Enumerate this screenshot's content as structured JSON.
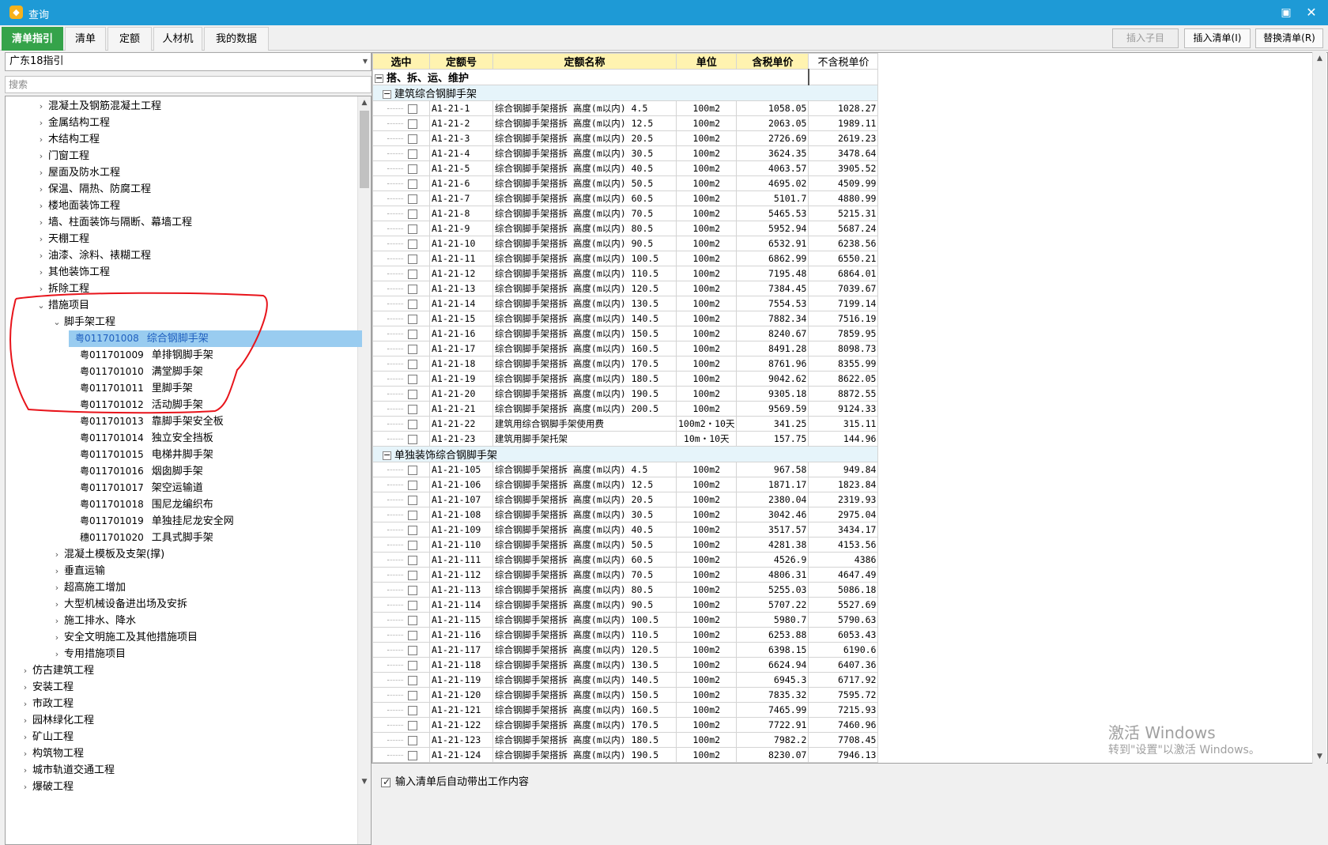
{
  "window": {
    "title": "查询",
    "icon": "app-icon"
  },
  "tabs": [
    {
      "label": "清单指引",
      "active": true
    },
    {
      "label": "清单"
    },
    {
      "label": "定额"
    },
    {
      "label": "人材机"
    },
    {
      "label": "我的数据"
    }
  ],
  "actions": {
    "insert_child": "插入子目",
    "insert_list": "插入清单(I)",
    "replace_list": "替换清单(R)"
  },
  "left": {
    "combo_value": "广东18指引",
    "search_placeholder": "搜索",
    "tree": [
      {
        "level": 1,
        "label": "混凝土及钢筋混凝土工程",
        "exp": "c"
      },
      {
        "level": 1,
        "label": "金属结构工程",
        "exp": "c"
      },
      {
        "level": 1,
        "label": "木结构工程",
        "exp": "c"
      },
      {
        "level": 1,
        "label": "门窗工程",
        "exp": "c"
      },
      {
        "level": 1,
        "label": "屋面及防水工程",
        "exp": "c"
      },
      {
        "level": 1,
        "label": "保温、隔热、防腐工程",
        "exp": "c"
      },
      {
        "level": 1,
        "label": "楼地面装饰工程",
        "exp": "c"
      },
      {
        "level": 1,
        "label": "墙、柱面装饰与隔断、幕墙工程",
        "exp": "c"
      },
      {
        "level": 1,
        "label": "天棚工程",
        "exp": "c"
      },
      {
        "level": 1,
        "label": "油漆、涂料、裱糊工程",
        "exp": "c"
      },
      {
        "level": 1,
        "label": "其他装饰工程",
        "exp": "c"
      },
      {
        "level": 1,
        "label": "拆除工程",
        "exp": "c"
      },
      {
        "level": 1,
        "label": "措施项目",
        "exp": "o"
      },
      {
        "level": 2,
        "label": "脚手架工程",
        "exp": "o"
      },
      {
        "level": 3,
        "code": "粤011701008",
        "label": "综合钢脚手架",
        "selected": true
      },
      {
        "level": 3,
        "code": "粤011701009",
        "label": "单排钢脚手架"
      },
      {
        "level": 3,
        "code": "粤011701010",
        "label": "满堂脚手架"
      },
      {
        "level": 3,
        "code": "粤011701011",
        "label": "里脚手架"
      },
      {
        "level": 3,
        "code": "粤011701012",
        "label": "活动脚手架"
      },
      {
        "level": 3,
        "code": "粤011701013",
        "label": "靠脚手架安全板"
      },
      {
        "level": 3,
        "code": "粤011701014",
        "label": "独立安全挡板"
      },
      {
        "level": 3,
        "code": "粤011701015",
        "label": "电梯井脚手架"
      },
      {
        "level": 3,
        "code": "粤011701016",
        "label": "烟囱脚手架"
      },
      {
        "level": 3,
        "code": "粤011701017",
        "label": "架空运输道"
      },
      {
        "level": 3,
        "code": "粤011701018",
        "label": "围尼龙编织布"
      },
      {
        "level": 3,
        "code": "粤011701019",
        "label": "单独挂尼龙安全网"
      },
      {
        "level": 3,
        "code": "穗011701020",
        "label": "工具式脚手架"
      },
      {
        "level": 2,
        "label": "混凝土模板及支架(撑)",
        "exp": "c"
      },
      {
        "level": 2,
        "label": "垂直运输",
        "exp": "c"
      },
      {
        "level": 2,
        "label": "超高施工增加",
        "exp": "c"
      },
      {
        "level": 2,
        "label": "大型机械设备进出场及安拆",
        "exp": "c"
      },
      {
        "level": 2,
        "label": "施工排水、降水",
        "exp": "c"
      },
      {
        "level": 2,
        "label": "安全文明施工及其他措施项目",
        "exp": "c"
      },
      {
        "level": 2,
        "label": "专用措施项目",
        "exp": "c"
      },
      {
        "level": 0,
        "label": "仿古建筑工程",
        "exp": "c"
      },
      {
        "level": 0,
        "label": "安装工程",
        "exp": "c"
      },
      {
        "level": 0,
        "label": "市政工程",
        "exp": "c"
      },
      {
        "level": 0,
        "label": "园林绿化工程",
        "exp": "c"
      },
      {
        "level": 0,
        "label": "矿山工程",
        "exp": "c"
      },
      {
        "level": 0,
        "label": "构筑物工程",
        "exp": "c"
      },
      {
        "level": 0,
        "label": "城市轨道交通工程",
        "exp": "c"
      },
      {
        "level": 0,
        "label": "爆破工程",
        "exp": "c"
      }
    ]
  },
  "grid": {
    "headers": [
      "选中",
      "定额号",
      "定额名称",
      "单位",
      "含税单价",
      "不含税单价"
    ],
    "top_group": "搭、拆、运、维护",
    "groups": [
      {
        "title": "建筑综合钢脚手架",
        "rows": [
          [
            "A1-21-1",
            "综合钢脚手架搭拆 高度(m以内) 4.5",
            "100m2",
            "1058.05",
            "1028.27"
          ],
          [
            "A1-21-2",
            "综合钢脚手架搭拆 高度(m以内) 12.5",
            "100m2",
            "2063.05",
            "1989.11"
          ],
          [
            "A1-21-3",
            "综合钢脚手架搭拆 高度(m以内) 20.5",
            "100m2",
            "2726.69",
            "2619.23"
          ],
          [
            "A1-21-4",
            "综合钢脚手架搭拆 高度(m以内) 30.5",
            "100m2",
            "3624.35",
            "3478.64"
          ],
          [
            "A1-21-5",
            "综合钢脚手架搭拆 高度(m以内) 40.5",
            "100m2",
            "4063.57",
            "3905.52"
          ],
          [
            "A1-21-6",
            "综合钢脚手架搭拆 高度(m以内) 50.5",
            "100m2",
            "4695.02",
            "4509.99"
          ],
          [
            "A1-21-7",
            "综合钢脚手架搭拆 高度(m以内) 60.5",
            "100m2",
            "5101.7",
            "4880.99"
          ],
          [
            "A1-21-8",
            "综合钢脚手架搭拆 高度(m以内) 70.5",
            "100m2",
            "5465.53",
            "5215.31"
          ],
          [
            "A1-21-9",
            "综合钢脚手架搭拆 高度(m以内) 80.5",
            "100m2",
            "5952.94",
            "5687.24"
          ],
          [
            "A1-21-10",
            "综合钢脚手架搭拆 高度(m以内) 90.5",
            "100m2",
            "6532.91",
            "6238.56"
          ],
          [
            "A1-21-11",
            "综合钢脚手架搭拆 高度(m以内) 100.5",
            "100m2",
            "6862.99",
            "6550.21"
          ],
          [
            "A1-21-12",
            "综合钢脚手架搭拆 高度(m以内) 110.5",
            "100m2",
            "7195.48",
            "6864.01"
          ],
          [
            "A1-21-13",
            "综合钢脚手架搭拆 高度(m以内) 120.5",
            "100m2",
            "7384.45",
            "7039.67"
          ],
          [
            "A1-21-14",
            "综合钢脚手架搭拆 高度(m以内) 130.5",
            "100m2",
            "7554.53",
            "7199.14"
          ],
          [
            "A1-21-15",
            "综合钢脚手架搭拆 高度(m以内) 140.5",
            "100m2",
            "7882.34",
            "7516.19"
          ],
          [
            "A1-21-16",
            "综合钢脚手架搭拆 高度(m以内) 150.5",
            "100m2",
            "8240.67",
            "7859.95"
          ],
          [
            "A1-21-17",
            "综合钢脚手架搭拆 高度(m以内) 160.5",
            "100m2",
            "8491.28",
            "8098.73"
          ],
          [
            "A1-21-18",
            "综合钢脚手架搭拆 高度(m以内) 170.5",
            "100m2",
            "8761.96",
            "8355.99"
          ],
          [
            "A1-21-19",
            "综合钢脚手架搭拆 高度(m以内) 180.5",
            "100m2",
            "9042.62",
            "8622.05"
          ],
          [
            "A1-21-20",
            "综合钢脚手架搭拆 高度(m以内) 190.5",
            "100m2",
            "9305.18",
            "8872.55"
          ],
          [
            "A1-21-21",
            "综合钢脚手架搭拆 高度(m以内) 200.5",
            "100m2",
            "9569.59",
            "9124.33"
          ],
          [
            "A1-21-22",
            "建筑用综合钢脚手架使用费",
            "100m2・10天",
            "341.25",
            "315.11"
          ],
          [
            "A1-21-23",
            "建筑用脚手架托架",
            "10m・10天",
            "157.75",
            "144.96"
          ]
        ]
      },
      {
        "title": "单独装饰综合钢脚手架",
        "rows": [
          [
            "A1-21-105",
            "综合钢脚手架搭拆 高度(m以内) 4.5",
            "100m2",
            "967.58",
            "949.84"
          ],
          [
            "A1-21-106",
            "综合钢脚手架搭拆 高度(m以内) 12.5",
            "100m2",
            "1871.17",
            "1823.84"
          ],
          [
            "A1-21-107",
            "综合钢脚手架搭拆 高度(m以内) 20.5",
            "100m2",
            "2380.04",
            "2319.93"
          ],
          [
            "A1-21-108",
            "综合钢脚手架搭拆 高度(m以内) 30.5",
            "100m2",
            "3042.46",
            "2975.04"
          ],
          [
            "A1-21-109",
            "综合钢脚手架搭拆 高度(m以内) 40.5",
            "100m2",
            "3517.57",
            "3434.17"
          ],
          [
            "A1-21-110",
            "综合钢脚手架搭拆 高度(m以内) 50.5",
            "100m2",
            "4281.38",
            "4153.56"
          ],
          [
            "A1-21-111",
            "综合钢脚手架搭拆 高度(m以内) 60.5",
            "100m2",
            "4526.9",
            "4386"
          ],
          [
            "A1-21-112",
            "综合钢脚手架搭拆 高度(m以内) 70.5",
            "100m2",
            "4806.31",
            "4647.49"
          ],
          [
            "A1-21-113",
            "综合钢脚手架搭拆 高度(m以内) 80.5",
            "100m2",
            "5255.03",
            "5086.18"
          ],
          [
            "A1-21-114",
            "综合钢脚手架搭拆 高度(m以内) 90.5",
            "100m2",
            "5707.22",
            "5527.69"
          ],
          [
            "A1-21-115",
            "综合钢脚手架搭拆 高度(m以内) 100.5",
            "100m2",
            "5980.7",
            "5790.63"
          ],
          [
            "A1-21-116",
            "综合钢脚手架搭拆 高度(m以内) 110.5",
            "100m2",
            "6253.88",
            "6053.43"
          ],
          [
            "A1-21-117",
            "综合钢脚手架搭拆 高度(m以内) 120.5",
            "100m2",
            "6398.15",
            "6190.6"
          ],
          [
            "A1-21-118",
            "综合钢脚手架搭拆 高度(m以内) 130.5",
            "100m2",
            "6624.94",
            "6407.36"
          ],
          [
            "A1-21-119",
            "综合钢脚手架搭拆 高度(m以内) 140.5",
            "100m2",
            "6945.3",
            "6717.92"
          ],
          [
            "A1-21-120",
            "综合钢脚手架搭拆 高度(m以内) 150.5",
            "100m2",
            "7835.32",
            "7595.72"
          ],
          [
            "A1-21-121",
            "综合钢脚手架搭拆 高度(m以内) 160.5",
            "100m2",
            "7465.99",
            "7215.93"
          ],
          [
            "A1-21-122",
            "综合钢脚手架搭拆 高度(m以内) 170.5",
            "100m2",
            "7722.91",
            "7460.96"
          ],
          [
            "A1-21-123",
            "综合钢脚手架搭拆 高度(m以内) 180.5",
            "100m2",
            "7982.2",
            "7708.45"
          ],
          [
            "A1-21-124",
            "综合钢脚手架搭拆 高度(m以内) 190.5",
            "100m2",
            "8230.07",
            "7946.13"
          ]
        ]
      }
    ]
  },
  "footer": {
    "auto_bring_label": "输入清单后自动带出工作内容",
    "auto_bring_checked": true
  },
  "watermark": {
    "line1": "激活 Windows",
    "line2": "转到\"设置\"以激活 Windows。"
  },
  "colors": {
    "titlebar": "#1e9ad6",
    "active_tab": "#35a34a",
    "header_bg": "#fff3b0",
    "selection": "#99ccf0",
    "annotation": "#e8141b"
  }
}
